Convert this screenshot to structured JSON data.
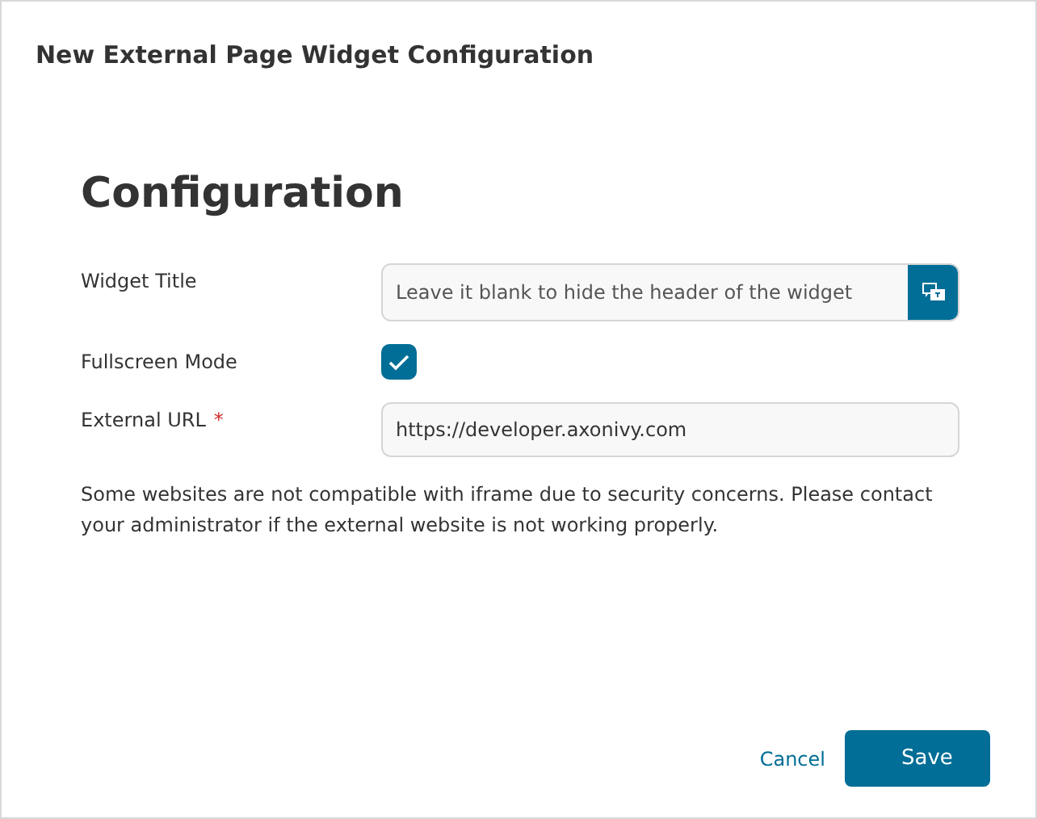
{
  "dialog": {
    "title": "New External Page Widget Configuration"
  },
  "heading": "Configuration",
  "fields": [
    {
      "kind": "text",
      "label": "Widget Title",
      "placeholder": "Leave it blank to hide the header of the widget"
    },
    {
      "kind": "checkbox",
      "label": "Fullscreen Mode",
      "checked": true
    },
    {
      "kind": "url",
      "label": "External URL",
      "value": "https://developer.axonivy.com",
      "required_mark": "*"
    }
  ],
  "note": "Some websites are not compatible with iframe due to security concerns. Please contact your administrator if the external website is not working properly.",
  "buttons": {
    "cancel": "Cancel",
    "save": "Save"
  }
}
